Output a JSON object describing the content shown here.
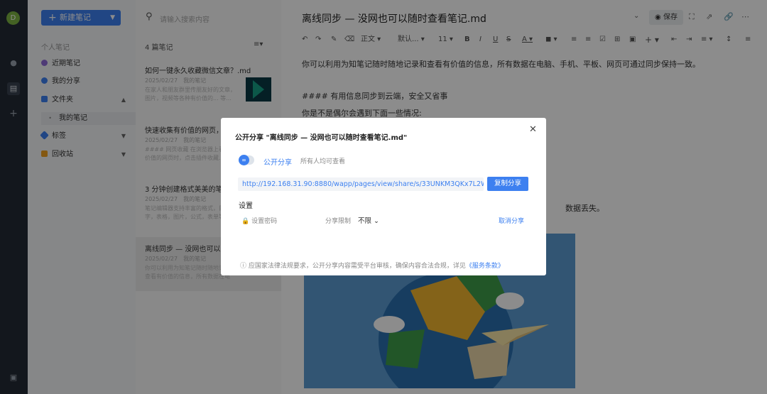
{
  "rail": {
    "avatar": "D",
    "icons": [
      "bell-icon",
      "notes-icon",
      "plus-icon",
      "settings-icon"
    ]
  },
  "sidebar": {
    "new_note": "新建笔记",
    "section": "个人笔记",
    "items": [
      {
        "label": "近期笔记",
        "color": "#8e6ad8"
      },
      {
        "label": "我的分享",
        "color": "#3d80f0"
      },
      {
        "label": "文件夹",
        "color": "#3d80f0"
      },
      {
        "label": "我的笔记",
        "color": ""
      },
      {
        "label": "标签",
        "color": "#3d80f0"
      },
      {
        "label": "回收站",
        "color": "#f0a020"
      }
    ]
  },
  "notelist": {
    "search_placeholder": "请输入搜索内容",
    "count": "4 篇笔记",
    "notes": [
      {
        "title": "如何一键永久收藏微信文章？.md",
        "meta": "2025/02/27　我的笔记",
        "excerpt": "在家人和朋友群里传朋友好的文章，图片，视频等各种有价值的... 等..."
      },
      {
        "title": "快速收集有价值的网页，保存到笔记.md",
        "meta": "2025/02/27　我的笔记",
        "excerpt": "#### 网页收藏 在浏览器上看到有价值的网页时，点击插件收藏..."
      },
      {
        "title": "3 分钟创建格式美美的笔记.md",
        "meta": "2025/02/27　我的笔记",
        "excerpt": "笔记编辑器支持丰富的格式，目标字，表格，图片，公式，表单等..."
      },
      {
        "title": "离线同步 — 没网也可以随时查看笔记.md",
        "meta": "2025/02/27　我的笔记",
        "excerpt": "你可以利用为知笔记随时随地记录和查看有价值的信息，所有数据在电脑..."
      }
    ]
  },
  "editor": {
    "title": "离线同步 — 没网也可以随时查看笔记.md",
    "save": "保存",
    "toolbar": {
      "para": "正文",
      "font": "默认...",
      "size": "11"
    },
    "lines": [
      "你可以利用为知笔记随时随地记录和查看有价值的信息，所有数据在电脑、手机、平板、网页可通过同步保持一致。",
      "#### 有用信息同步到云端，安全又省事",
      "你是不是偶尔会遇到下面一些情况:",
      "数据丢失。"
    ]
  },
  "modal": {
    "title": "公开分享 \"离线同步 — 没网也可以随时查看笔记.md\"",
    "public_share": "公开分享",
    "share_desc": "所有人均可查看",
    "url": "http://192.168.31.90:8880/wapp/pages/view/share/s/33UNKM3QKx7L2WfFsQ...",
    "copy": "复制分享",
    "settings": "设置",
    "password": "设置密码",
    "limit_label": "分享限制",
    "limit_value": "不限",
    "cancel": "取消分享",
    "notice": "应国家法律法规要求，公开分享内容需受平台审核，确保内容合法合规，详见",
    "terms": "《服务条款》"
  }
}
